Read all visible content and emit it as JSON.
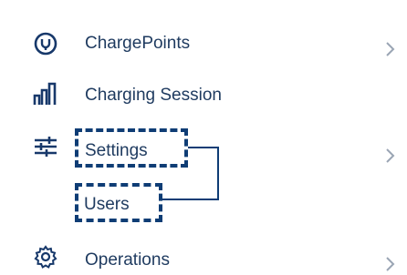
{
  "menu": {
    "items": [
      {
        "label": "ChargePoints",
        "icon": "charge-point-icon",
        "has_chevron": true
      },
      {
        "label": "Charging Session",
        "icon": "bar-chart-icon",
        "has_chevron": false
      },
      {
        "label": "Settings",
        "icon": "sliders-icon",
        "has_chevron": true
      },
      {
        "label": "Operations",
        "icon": "gear-icon",
        "has_chevron": true
      }
    ],
    "sub_items": [
      {
        "label": "Users"
      }
    ]
  },
  "colors": {
    "text": "#1e3a5f",
    "icon": "#17386a",
    "chevron": "#9aa5b4",
    "annotation": "#0f3d75"
  }
}
